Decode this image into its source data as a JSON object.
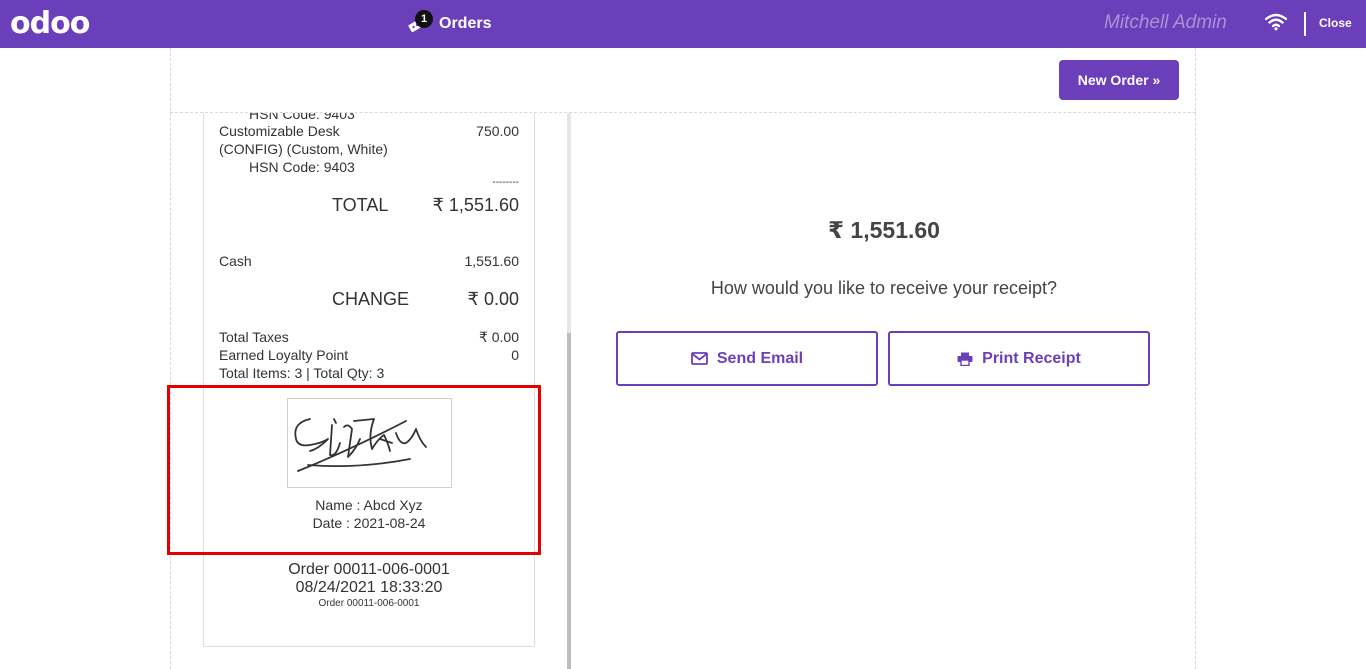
{
  "header": {
    "logo": "odoo",
    "orders_label": "Orders",
    "orders_count": "1",
    "cashier": "Mitchell Admin",
    "close_label": "Close"
  },
  "toolbar": {
    "new_order_label": "New Order »"
  },
  "receipt": {
    "prev_hsn": "HSN Code: 9403",
    "item_name_1": "Customizable Desk",
    "item_name_2": "(CONFIG) (Custom, White)",
    "item_price": "750.00",
    "item_hsn": "HSN Code: 9403",
    "divider": "--------",
    "total_label": "TOTAL",
    "total_value": "₹ 1,551.60",
    "payment_method": "Cash",
    "payment_value": "1,551.60",
    "change_label": "CHANGE",
    "change_value": "₹ 0.00",
    "taxes_label": "Total Taxes",
    "taxes_value": "₹ 0.00",
    "loyalty_label": "Earned Loyalty Point",
    "loyalty_value": "0",
    "items_summary": "Total Items: 3 | Total Qty: 3",
    "signature_name": "Name : Abcd Xyz",
    "signature_date": "Date : 2021-08-24",
    "order_ref": "Order 00011-006-0001",
    "order_datetime": "08/24/2021 18:33:20",
    "order_ref_small": "Order 00011-006-0001"
  },
  "payment_screen": {
    "amount": "₹ 1,551.60",
    "question": "How would you like to receive your receipt?",
    "send_email_label": "Send Email",
    "print_receipt_label": "Print Receipt"
  },
  "colors": {
    "brand": "#6b3fb9",
    "highlight": "#e40000"
  }
}
